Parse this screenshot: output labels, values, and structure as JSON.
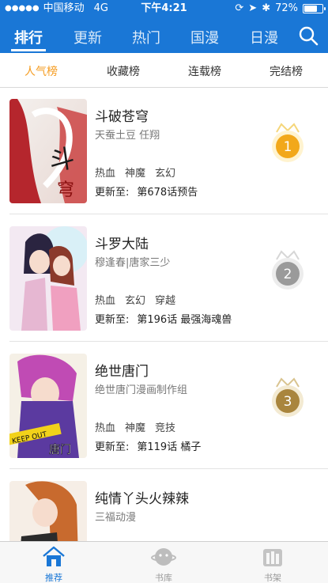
{
  "status": {
    "carrier": "中国移动",
    "network": "4G",
    "time": "下午4:21",
    "battery": "72%",
    "battery_level": 0.72
  },
  "nav": {
    "tabs": [
      "排行",
      "更新",
      "热门",
      "国漫",
      "日漫"
    ],
    "active": "排行",
    "search_icon": "search-icon"
  },
  "subtabs": {
    "items": [
      "人气榜",
      "收藏榜",
      "连载榜",
      "完结榜"
    ],
    "active": "人气榜",
    "active_color": "#f59b1e"
  },
  "comics": [
    {
      "title": "斗破苍穹",
      "author": "天蚕土豆 任翔",
      "tags": [
        "热血",
        "神魔",
        "玄幻"
      ],
      "update_label": "更新至:",
      "update_value": "第678话预告",
      "rank": "1",
      "medal_color": "#f2a81b"
    },
    {
      "title": "斗罗大陆",
      "author": "穆逢春|唐家三少",
      "tags": [
        "热血",
        "玄幻",
        "穿越"
      ],
      "update_label": "更新至:",
      "update_value": "第196话 最强海魂兽",
      "rank": "2",
      "medal_color": "#9a9a9a"
    },
    {
      "title": "绝世唐门",
      "author": "绝世唐门漫画制作组",
      "tags": [
        "热血",
        "神魔",
        "竞技"
      ],
      "update_label": "更新至:",
      "update_value": "第119话 橘子",
      "rank": "3",
      "medal_color": "#a9853d"
    },
    {
      "title": "纯情丫头火辣辣",
      "author": "三福动漫",
      "tags": [],
      "update_label": "",
      "update_value": ""
    }
  ],
  "tabbar": {
    "items": [
      {
        "label": "推荐",
        "icon": "home-icon"
      },
      {
        "label": "书库",
        "icon": "planet-icon"
      },
      {
        "label": "书架",
        "icon": "bookshelf-icon"
      }
    ],
    "active": "推荐",
    "accent": "#1a77d6"
  },
  "colors": {
    "header": "#1a77d6"
  }
}
